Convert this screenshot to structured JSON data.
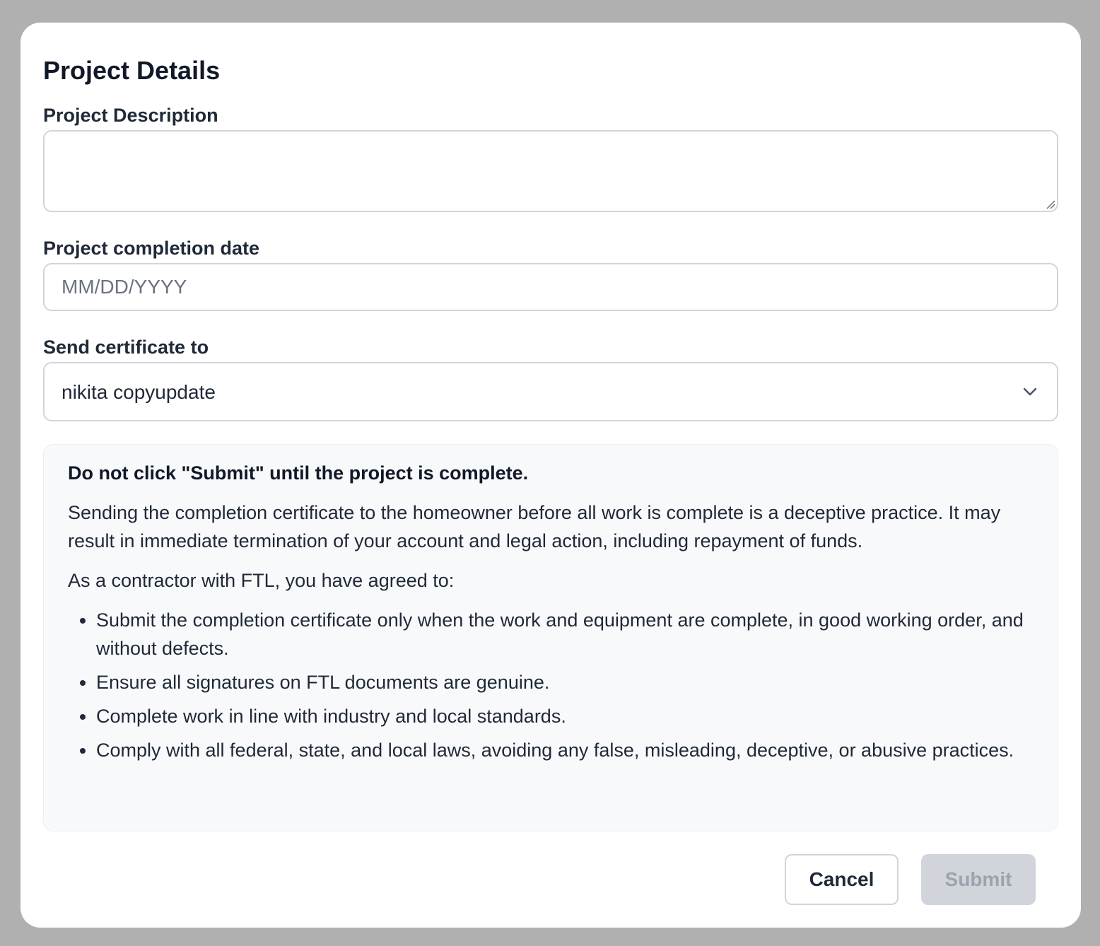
{
  "modal": {
    "title": "Project Details"
  },
  "fields": {
    "description_label": "Project Description",
    "description_value": "",
    "date_label": "Project completion date",
    "date_placeholder": "MM/DD/YYYY",
    "send_label": "Send certificate to",
    "send_selected": "nikita copyupdate"
  },
  "notice": {
    "heading": "Do not click \"Submit\" until the project is complete.",
    "body": "Sending the completion certificate to the homeowner before all work is complete is a deceptive practice. It may result in immediate termination of your account and legal action, including repayment of funds.",
    "intro": "As a contractor with FTL, you have agreed to:",
    "items": [
      "Submit the completion certificate only when the work and equipment are complete, in good working order, and without defects.",
      "Ensure all signatures on FTL documents are genuine.",
      "Complete work in line with industry and local standards.",
      "Comply with all federal, state, and local laws, avoiding any false, misleading, deceptive, or abusive practices."
    ]
  },
  "actions": {
    "cancel_label": "Cancel",
    "submit_label": "Submit"
  },
  "icons": {
    "select": "chevron-down-icon",
    "textarea": "resize-grip-icon"
  },
  "colors": {
    "overlay": "#b0b0b0",
    "border": "#d1d5db",
    "submit_disabled_bg": "#d1d5db",
    "submit_disabled_text": "#9ca3af",
    "notice_bg": "#f8f9fb"
  }
}
